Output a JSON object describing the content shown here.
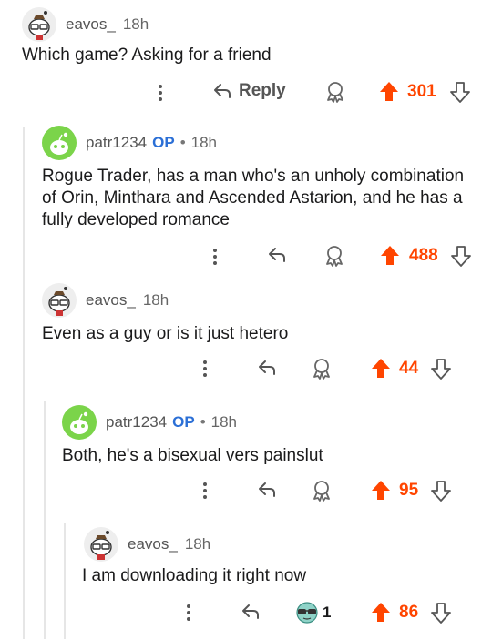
{
  "accent": "#ff4500",
  "op_color": "#2b6fd6",
  "comments": [
    {
      "user": "eavos_",
      "time": "18h",
      "body": "Which game? Asking for a friend",
      "reply_label": "Reply",
      "score": "301"
    },
    {
      "user": "patr1234",
      "op": "OP",
      "sep": "•",
      "time": "18h",
      "body": "Rogue Trader, has a man who's an unholy combination of Orin, Minthara and Ascended Astarion, and he has a fully developed romance",
      "score": "488"
    },
    {
      "user": "eavos_",
      "time": "18h",
      "body": "Even as a guy or is it just hetero",
      "score": "44"
    },
    {
      "user": "patr1234",
      "op": "OP",
      "sep": "•",
      "time": "18h",
      "body": "Both, he's a bisexual vers painslut",
      "score": "95"
    },
    {
      "user": "eavos_",
      "time": "18h",
      "body": "I am downloading it right now",
      "award_count": "1",
      "score": "86"
    }
  ],
  "icons": [
    "more-icon",
    "reply-icon",
    "award-icon",
    "upvote-icon",
    "downvote-icon",
    "snoo-avatar-icon",
    "glasses-award-icon"
  ]
}
